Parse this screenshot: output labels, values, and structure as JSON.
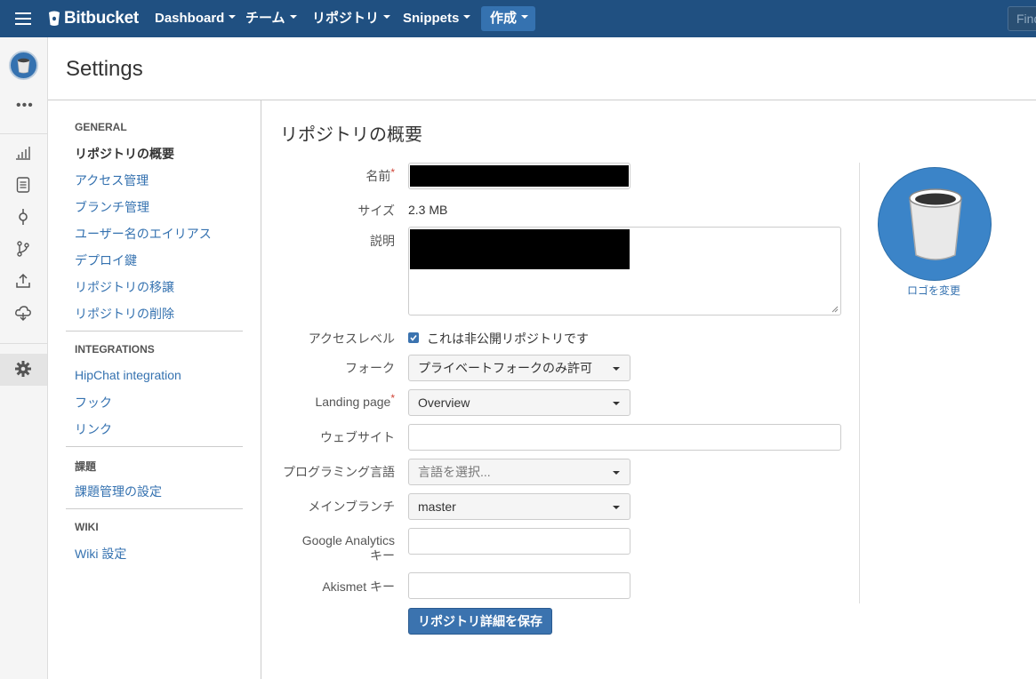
{
  "topbar": {
    "brand": "Bitbucket",
    "nav": [
      {
        "label": "Dashboard"
      },
      {
        "label": "チーム"
      },
      {
        "label": "リポジトリ"
      },
      {
        "label": "Snippets"
      }
    ],
    "create_label": "作成",
    "search_placeholder": "Find"
  },
  "leftbar": {
    "more_label": "•••",
    "icons": [
      "chart-icon",
      "source-icon",
      "commits-icon",
      "branches-icon",
      "pull-request-icon",
      "pipelines-icon",
      "settings-icon"
    ]
  },
  "page": {
    "title": "Settings"
  },
  "settings_nav": {
    "general_heading": "GENERAL",
    "general_items": [
      {
        "label": "リポジトリの概要",
        "active": true
      },
      {
        "label": "アクセス管理"
      },
      {
        "label": "ブランチ管理"
      },
      {
        "label": "ユーザー名のエイリアス"
      },
      {
        "label": "デプロイ鍵"
      },
      {
        "label": "リポジトリの移譲"
      },
      {
        "label": "リポジトリの削除"
      }
    ],
    "integrations_heading": "INTEGRATIONS",
    "integrations_items": [
      {
        "label": "HipChat integration"
      },
      {
        "label": "フック"
      },
      {
        "label": "リンク"
      }
    ],
    "issues_heading": "課題",
    "issues_items": [
      {
        "label": "課題管理の設定"
      }
    ],
    "wiki_heading": "WIKI",
    "wiki_items": [
      {
        "label": "Wiki 設定"
      }
    ]
  },
  "form": {
    "section_title": "リポジトリの概要",
    "name_label": "名前",
    "required_mark": "*",
    "size_label": "サイズ",
    "size_value": "2.3 MB",
    "description_label": "説明",
    "access_label": "アクセスレベル",
    "private_checked": true,
    "private_label": "これは非公開リポジトリです",
    "fork_label": "フォーク",
    "fork_value": "プライベートフォークのみ許可",
    "landing_label": "Landing page",
    "landing_value": "Overview",
    "website_label": "ウェブサイト",
    "website_value": "",
    "language_label": "プログラミング言語",
    "language_placeholder": "言語を選択...",
    "main_branch_label": "メインブランチ",
    "main_branch_value": "master",
    "ga_label_line1": "Google Analytics",
    "ga_label_line2": "キー",
    "ga_value": "",
    "akismet_label": "Akismet キー",
    "akismet_value": "",
    "save_label": "リポジトリ詳細を保存"
  },
  "logo": {
    "change_label": "ロゴを変更"
  },
  "colors": {
    "topbar": "#205081",
    "link": "#3572b0",
    "button": "#3b73af",
    "required": "#d04437"
  }
}
